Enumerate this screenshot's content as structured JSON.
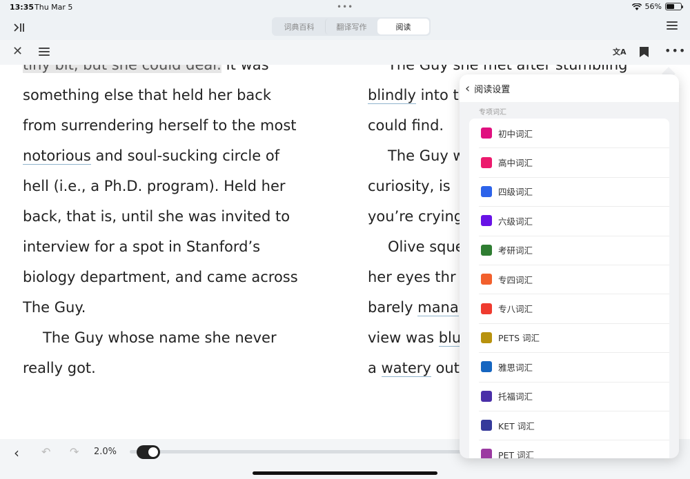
{
  "status_bar": {
    "time": "13:35",
    "date": "Thu Mar 5",
    "battery_text": "56%",
    "battery_level": 0.56
  },
  "top_tabs": [
    {
      "label": "词典百科",
      "active": false
    },
    {
      "label": "翻译写作",
      "active": false
    },
    {
      "label": "阅读",
      "active": true
    }
  ],
  "reader": {
    "left_lines": [
      {
        "text": "tiny bit, but she could deal. It was",
        "parts": [
          {
            "t": "tiny bit, but she could deal.",
            "s": "hl"
          },
          {
            "t": " It was",
            "s": ""
          }
        ],
        "indent": false
      },
      {
        "parts": [
          {
            "t": "something else that held her back",
            "s": ""
          }
        ],
        "indent": false
      },
      {
        "parts": [
          {
            "t": "from surrendering herself to the most",
            "s": ""
          }
        ],
        "indent": false
      },
      {
        "parts": [
          {
            "t": "notorious",
            "s": "ul"
          },
          {
            "t": " and soul-sucking circle of",
            "s": ""
          }
        ],
        "indent": false
      },
      {
        "parts": [
          {
            "t": "hell (i.e., a Ph.D. program). Held her",
            "s": ""
          }
        ],
        "indent": false
      },
      {
        "parts": [
          {
            "t": "back, that is, until she was invited to",
            "s": ""
          }
        ],
        "indent": false
      },
      {
        "parts": [
          {
            "t": "interview for a spot in Stanford’s",
            "s": ""
          }
        ],
        "indent": false
      },
      {
        "parts": [
          {
            "t": "biology department, and came across",
            "s": ""
          }
        ],
        "indent": false
      },
      {
        "parts": [
          {
            "t": "The Guy.",
            "s": ""
          }
        ],
        "indent": false
      },
      {
        "parts": [
          {
            "t": "The Guy whose name she never",
            "s": ""
          }
        ],
        "indent": true
      },
      {
        "parts": [
          {
            "t": "really got.",
            "s": ""
          }
        ],
        "indent": false
      }
    ],
    "right_lines": [
      {
        "parts": [
          {
            "t": "The Guy she met after stumbling",
            "s": ""
          }
        ],
        "indent": true
      },
      {
        "parts": [
          {
            "t": "blindly",
            "s": "ul"
          },
          {
            "t": " into t",
            "s": ""
          }
        ],
        "indent": false
      },
      {
        "parts": [
          {
            "t": "could find.",
            "s": ""
          }
        ],
        "indent": false
      },
      {
        "parts": [
          {
            "t": "The Guy w",
            "s": ""
          }
        ],
        "indent": true
      },
      {
        "parts": [
          {
            "t": "curiosity, is",
            "s": ""
          }
        ],
        "indent": false
      },
      {
        "parts": [
          {
            "t": "you’re crying",
            "s": ""
          }
        ],
        "indent": false
      },
      {
        "parts": [
          {
            "t": "Olive sque",
            "s": ""
          }
        ],
        "indent": true
      },
      {
        "parts": [
          {
            "t": "her eyes thr",
            "s": ""
          }
        ],
        "indent": false
      },
      {
        "parts": [
          {
            "t": "barely ",
            "s": ""
          },
          {
            "t": "mana",
            "s": "ul"
          }
        ],
        "indent": false
      },
      {
        "parts": [
          {
            "t": "view was ",
            "s": ""
          },
          {
            "t": "blu",
            "s": "ul"
          }
        ],
        "indent": false
      },
      {
        "parts": [
          {
            "t": "a ",
            "s": ""
          },
          {
            "t": "watery",
            "s": "ul"
          },
          {
            "t": " out",
            "s": ""
          }
        ],
        "indent": false
      }
    ]
  },
  "bottom_bar": {
    "progress_text": "2.0%",
    "progress": 0.02
  },
  "settings_panel": {
    "title": "阅读设置",
    "section_label": "专项词汇",
    "items": [
      {
        "label": "初中词汇",
        "color": "#e0107f"
      },
      {
        "label": "高中词汇",
        "color": "#ec1a6d"
      },
      {
        "label": "四级词汇",
        "color": "#2d63ea"
      },
      {
        "label": "六级词汇",
        "color": "#6812e6"
      },
      {
        "label": "考研词汇",
        "color": "#2f7d32"
      },
      {
        "label": "专四词汇",
        "color": "#f2602d"
      },
      {
        "label": "专八词汇",
        "color": "#ef3b2f"
      },
      {
        "label": "PETS 词汇",
        "color": "#b8920e"
      },
      {
        "label": "雅思词汇",
        "color": "#1565c0"
      },
      {
        "label": "托福词汇",
        "color": "#4a2fa8"
      },
      {
        "label": "KET 词汇",
        "color": "#353a9a"
      },
      {
        "label": "PET 词汇",
        "color": "#9b3aa1"
      }
    ]
  }
}
